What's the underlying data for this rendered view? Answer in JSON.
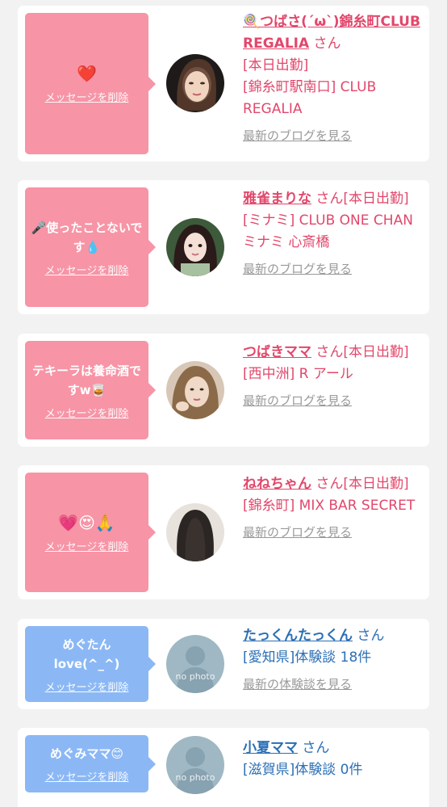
{
  "messages": [
    {
      "bubble_text": "❤️",
      "delete_label": "メッセージを削除",
      "name": "🍭つばさ(´ω`)錦糸町CLUB REGALIA",
      "honorific": "さん",
      "line1": "[本日出勤]",
      "line2": "[錦糸町駅南口] CLUB REGALIA",
      "link": "最新のブログを見る"
    },
    {
      "bubble_text": "🎤使ったことないです💧",
      "delete_label": "メッセージを削除",
      "name": "雅雀まりな",
      "honorific": "さん[本日出勤]",
      "line1": "[ミナミ] CLUB ONE CHAN ミナミ 心斎橋",
      "link": "最新のブログを見る"
    },
    {
      "bubble_text": "テキーラは養命酒ですw🥃",
      "delete_label": "メッセージを削除",
      "name": "つばきママ",
      "honorific": "さん[本日出勤]",
      "line1": "[西中洲] R アール",
      "link": "最新のブログを見る"
    },
    {
      "bubble_text": "💗😍🙏",
      "delete_label": "メッセージを削除",
      "name": "ねねちゃん",
      "honorific": "さん[本日出勤]",
      "line1": "[錦糸町] MIX BAR SECRET",
      "link": "最新のブログを見る"
    },
    {
      "bubble_text": "めぐたんlove(^_^)",
      "delete_label": "メッセージを削除",
      "name": "たっくんたっくん",
      "honorific": "さん",
      "line1": "[愛知県]体験談 18件",
      "link": "最新の体験談を見る",
      "avatar_text": "no photo"
    },
    {
      "bubble_text": "めぐみママ😊",
      "delete_label": "メッセージを削除",
      "name": "小夏ママ",
      "honorific": "さん",
      "line1": "[滋賀県]体験談 0件",
      "avatar_text": "no photo"
    }
  ],
  "colors": {
    "page_bg": "#f2f2f2",
    "pink_bubble": "#f794a6",
    "blue_bubble": "#8bb8f5",
    "pink_text": "#e2476b",
    "blue_text": "#2b6fb5",
    "link_gray": "#999999"
  },
  "icons": {
    "avatar_photo": "avatar-photo",
    "avatar_placeholder": "no-photo-silhouette-icon"
  }
}
